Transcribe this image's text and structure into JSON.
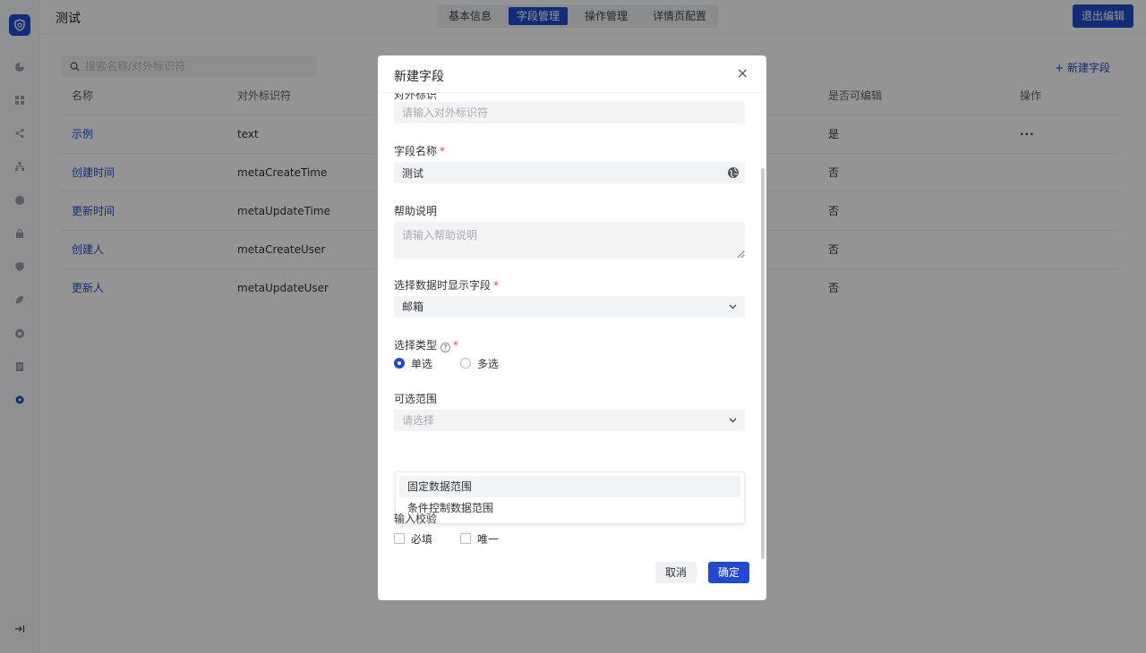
{
  "header": {
    "title": "测试",
    "tabs": [
      "基本信息",
      "字段管理",
      "操作管理",
      "详情页配置"
    ],
    "active_tab": "字段管理",
    "exit_label": "退出编辑"
  },
  "toolbar": {
    "search_placeholder": "搜索名称/对外标识符",
    "new_field_label": "+ 新建字段"
  },
  "table": {
    "headers": [
      "名称",
      "对外标识符",
      "是否可编辑",
      "操作"
    ],
    "rows": [
      {
        "name": "示例",
        "identifier": "text",
        "editable": "是",
        "action": "···"
      },
      {
        "name": "创建时间",
        "identifier": "metaCreateTime",
        "editable": "否"
      },
      {
        "name": "更新时间",
        "identifier": "metaUpdateTime",
        "editable": "否"
      },
      {
        "name": "创建人",
        "identifier": "metaCreateUser",
        "editable": "否"
      },
      {
        "name": "更新人",
        "identifier": "metaUpdateUser",
        "editable": "否"
      }
    ]
  },
  "modal": {
    "title": "新建字段",
    "close_label": "×",
    "cutoff_label": "对外标识",
    "identifier_placeholder": "请输入对外标识符",
    "field_name_label": "字段名称",
    "field_name_value": "测试",
    "help_label": "帮助说明",
    "help_placeholder": "请输入帮助说明",
    "display_field_label": "选择数据时显示字段",
    "display_field_value": "邮箱",
    "select_type_label": "选择类型",
    "select_type_options": [
      "单选",
      "多选"
    ],
    "select_type_selected": "单选",
    "range_label": "可选范围",
    "range_placeholder": "请选择",
    "range_options": [
      "固定数据范围",
      "条件控制数据范围"
    ],
    "validation_label": "输入校验",
    "validation_options": [
      "必填",
      "唯一"
    ],
    "cancel_label": "取消",
    "confirm_label": "确定",
    "required_mark": "*",
    "help_icon": "?"
  },
  "colors": {
    "primary": "#1f4ccf",
    "required": "#e0443a"
  },
  "icons": {
    "logo": "shield-logo-icon",
    "sidebar": [
      "pie-chart-icon",
      "grid-icon",
      "share-icon",
      "org-chart-icon",
      "circle-icon",
      "lock-icon",
      "shield-icon",
      "leaf-icon",
      "eye-icon",
      "document-icon",
      "settings-icon",
      "collapse-icon"
    ]
  }
}
